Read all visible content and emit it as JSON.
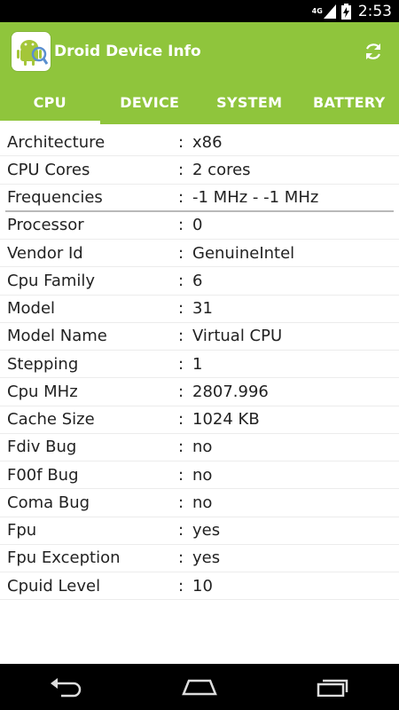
{
  "status_bar": {
    "network": "4G",
    "time": "2:53"
  },
  "app": {
    "title": "Droid Device Info",
    "icon": "android-robot-icon",
    "accent_color": "#8fc53c"
  },
  "tabs": [
    {
      "label": "CPU",
      "active": true
    },
    {
      "label": "DEVICE",
      "active": false
    },
    {
      "label": "SYSTEM",
      "active": false
    },
    {
      "label": "BATTERY",
      "active": false
    }
  ],
  "info": [
    {
      "label": "Architecture",
      "value": "x86"
    },
    {
      "label": "CPU Cores",
      "value": "2 cores"
    },
    {
      "label": "Frequencies",
      "value": "-1 MHz - -1 MHz"
    },
    {
      "label": "Processor",
      "value": "0"
    },
    {
      "label": "Vendor Id",
      "value": "GenuineIntel"
    },
    {
      "label": "Cpu Family",
      "value": "6"
    },
    {
      "label": "Model",
      "value": "31"
    },
    {
      "label": "Model Name",
      "value": "Virtual CPU"
    },
    {
      "label": "Stepping",
      "value": "1"
    },
    {
      "label": "Cpu MHz",
      "value": "2807.996"
    },
    {
      "label": "Cache Size",
      "value": "1024 KB"
    },
    {
      "label": "Fdiv Bug",
      "value": "no"
    },
    {
      "label": "F00f Bug",
      "value": "no"
    },
    {
      "label": "Coma Bug",
      "value": "no"
    },
    {
      "label": "Fpu",
      "value": "yes"
    },
    {
      "label": "Fpu Exception",
      "value": "yes"
    },
    {
      "label": "Cpuid Level",
      "value": "10"
    }
  ],
  "separator": ":"
}
